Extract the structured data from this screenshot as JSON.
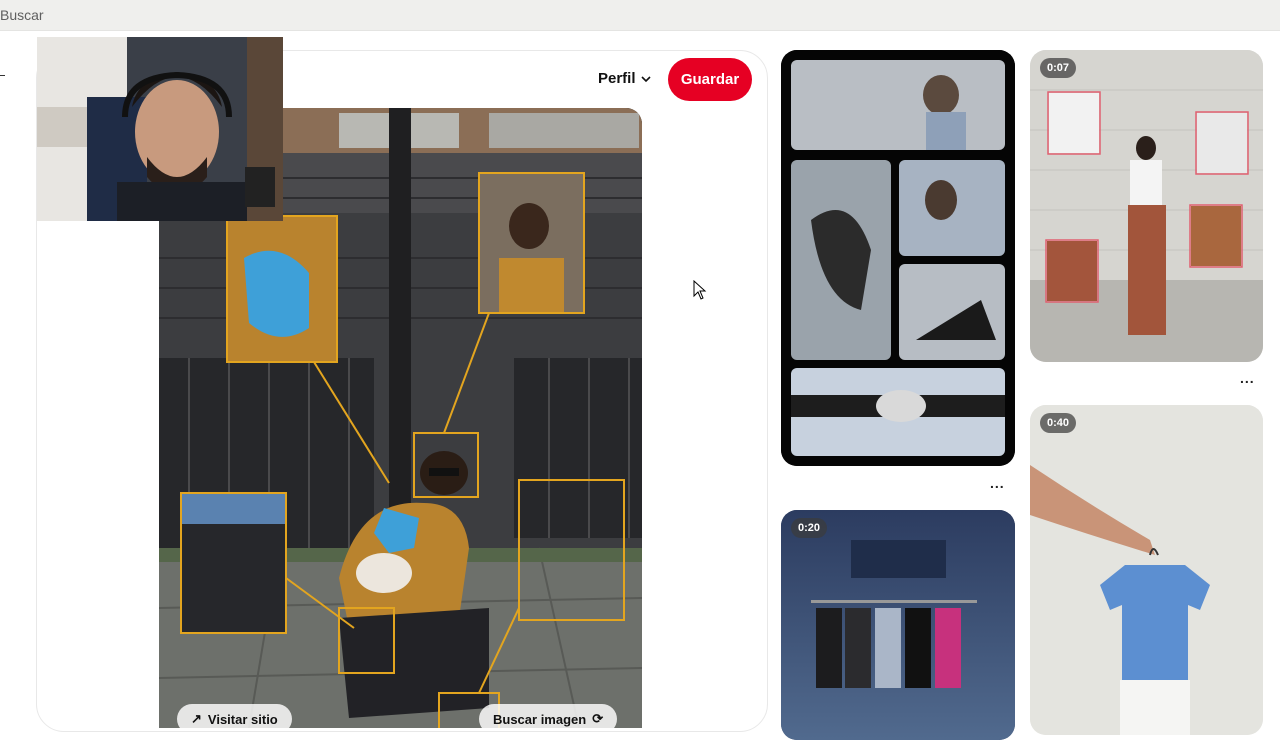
{
  "search": {
    "placeholder": "Buscar"
  },
  "pin_header": {
    "profile_label": "Perfil",
    "save_label": "Guardar"
  },
  "image_actions": {
    "visit_label": "Visitar sitio",
    "search_image_label": "Buscar imagen"
  },
  "feed": [
    {
      "id": "collage-pin",
      "badge": ""
    },
    {
      "id": "lookbook-pin",
      "badge": "0:07"
    },
    {
      "id": "evolve-pin",
      "badge": "0:20"
    },
    {
      "id": "sale-pin",
      "badge": "0:40"
    }
  ],
  "more_label": "...",
  "colors": {
    "accent": "#e60023",
    "topbar": "#efefed",
    "highlight_box": "#e3a51f"
  }
}
